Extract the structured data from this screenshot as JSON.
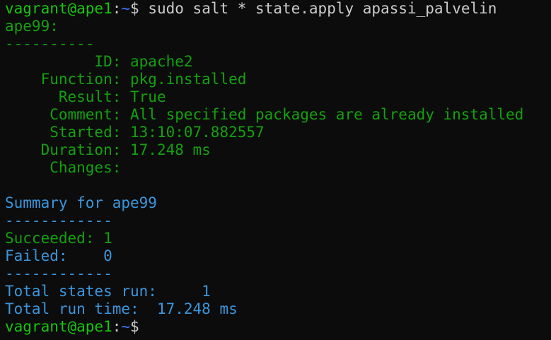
{
  "colors": {
    "background": "#0c0c0c",
    "green": "#13a10e",
    "bright_green": "#16c60c",
    "blue": "#3a96dd",
    "path_blue": "#3b78ff",
    "text": "#cccccc"
  },
  "prompt": {
    "user_host": "vagrant@ape1",
    "colon": ":",
    "path": "~",
    "symbol": "$"
  },
  "command": " sudo salt * state.apply apassi_palvelin",
  "minion": {
    "name": "ape99:",
    "separator": "----------",
    "fields": [
      {
        "label": "          ID:",
        "value": " apache2"
      },
      {
        "label": "    Function:",
        "value": " pkg.installed"
      },
      {
        "label": "      Result:",
        "value": " True"
      },
      {
        "label": "     Comment:",
        "value": " All specified packages are already installed"
      },
      {
        "label": "     Started:",
        "value": " 13:10:07.882557"
      },
      {
        "label": "    Duration:",
        "value": " 17.248 ms"
      },
      {
        "label": "     Changes:",
        "value": ""
      }
    ]
  },
  "summary": {
    "title": "Summary for ape99",
    "separator": "------------",
    "succeeded_label": "Succeeded:",
    "succeeded_value": " 1",
    "failed_label": "Failed:",
    "failed_value": "    0",
    "separator2": "------------",
    "total_states_label": "Total states run:",
    "total_states_value": "     1",
    "total_time_label": "Total run time:",
    "total_time_value": "  17.248 ms"
  }
}
